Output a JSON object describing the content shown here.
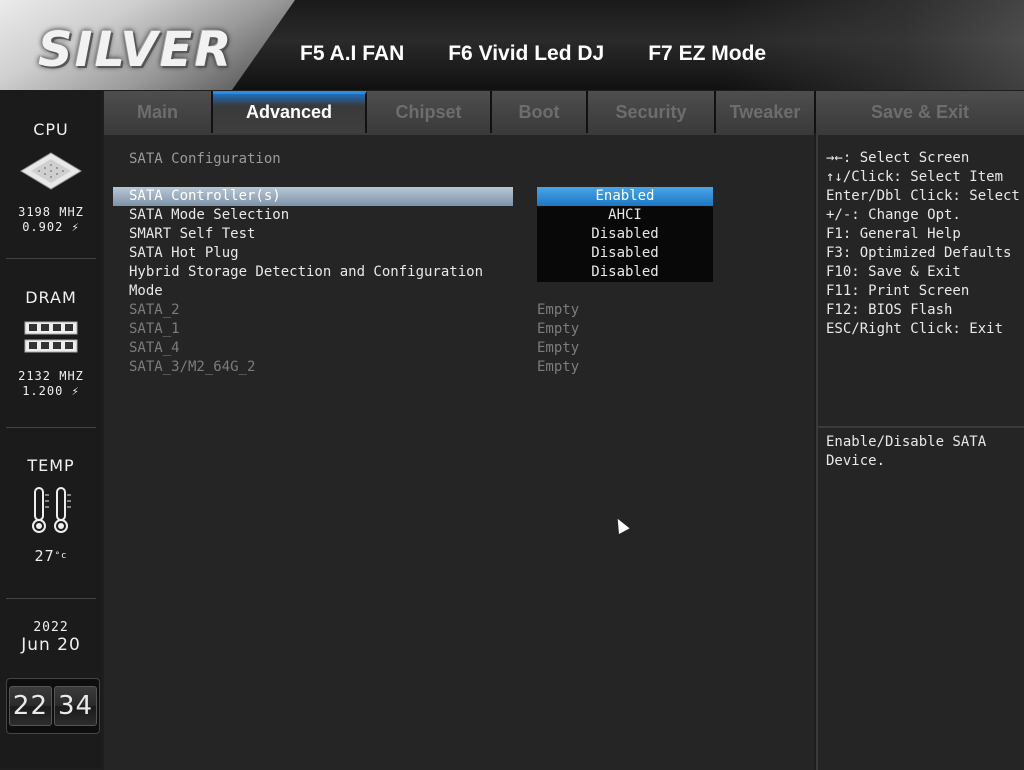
{
  "header": {
    "logo": "SILVER",
    "hotkeys": [
      "F5 A.I FAN",
      "F6 Vivid Led DJ",
      "F7 EZ Mode"
    ]
  },
  "sidebar": {
    "cpu": {
      "title": "CPU",
      "freq": "3198 MHZ",
      "volt": "0.902",
      "icon": "cpu-chip-icon"
    },
    "dram": {
      "title": "DRAM",
      "freq": "2132 MHZ",
      "volt": "1.200",
      "icon": "memory-module-icon"
    },
    "temp": {
      "title": "TEMP",
      "value": "27",
      "unit": "°c",
      "icon": "thermometer-icon"
    },
    "date": {
      "year": "2022",
      "month": "Jun",
      "day": "20"
    },
    "clock": {
      "hours": "22",
      "minutes": "34"
    }
  },
  "tabs": [
    {
      "label": "Main",
      "active": false
    },
    {
      "label": "Advanced",
      "active": true
    },
    {
      "label": "Chipset",
      "active": false
    },
    {
      "label": "Boot",
      "active": false
    },
    {
      "label": "Security",
      "active": false
    },
    {
      "label": "Tweaker",
      "active": false
    },
    {
      "label": "Save & Exit",
      "active": false
    }
  ],
  "main": {
    "section_title": "SATA Configuration",
    "settings": [
      {
        "label": "SATA Controller(s)",
        "value": "Enabled",
        "selected": true
      },
      {
        "label": "SATA Mode Selection",
        "value": "AHCI",
        "selected": false
      },
      {
        "label": "SMART Self Test",
        "value": "Disabled",
        "selected": false
      },
      {
        "label": "SATA Hot Plug",
        "value": "Disabled",
        "selected": false
      },
      {
        "label": "Hybrid Storage Detection and Configuration Mode",
        "value": "Disabled",
        "selected": false
      }
    ],
    "ports": [
      {
        "label": "SATA_2",
        "value": "Empty"
      },
      {
        "label": "SATA_1",
        "value": "Empty"
      },
      {
        "label": "SATA_4",
        "value": "Empty"
      },
      {
        "label": "SATA_3/M2_64G_2",
        "value": "Empty"
      }
    ]
  },
  "help": {
    "keys": [
      "→←: Select Screen",
      "↑↓/Click: Select Item",
      "Enter/Dbl Click: Select",
      "+/-: Change Opt.",
      "F1: General Help",
      "F3: Optimized Defaults",
      "F10: Save & Exit",
      "F11: Print Screen",
      "F12: BIOS Flash",
      "ESC/Right Click: Exit"
    ],
    "description": "Enable/Disable SATA Device."
  },
  "colors": {
    "accent": "#1c77c4",
    "selected_row": "#8fa3b8"
  }
}
